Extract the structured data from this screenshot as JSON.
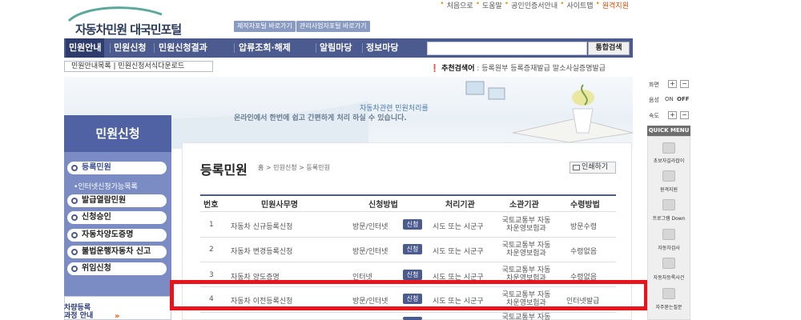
{
  "header": {
    "logo_text": "자동차민원 대국민포털",
    "btn_manufacturer": "제작자포털 바로가기",
    "btn_management": "관리사업자포털 바로가기",
    "top_links": [
      "처음으로",
      "도움말",
      "공인인증서안내",
      "사이트맵",
      "원격지원"
    ]
  },
  "nav": {
    "items": [
      "민원안내",
      "민원신청",
      "민원신청결과",
      "압류조회·해제",
      "알림마당",
      "정보마당"
    ],
    "search_button": "통합검색"
  },
  "subnav": {
    "text": "민원안내목록 | 민원신청서식다운로드"
  },
  "recommend": {
    "label": "추천검색어",
    "terms": "등록원부   등록증재발급   말소사실증명발급"
  },
  "banner": {
    "line1": "자동차관련 민원처리를",
    "line2": "온라인에서 한번에 쉽고 간편하게 처리 하실 수 있습니다."
  },
  "sidebar": {
    "title": "민원신청",
    "items": [
      "등록민원",
      "발급열람민원",
      "신청승인",
      "자동차양도증명",
      "불법운행자동차 신고",
      "위임신청"
    ],
    "sub_item": "인터넷신청가능목록",
    "promo_line1": "차량등록",
    "promo_line2": "과정 안내",
    "promo_arrow": "»"
  },
  "content": {
    "title": "등록민원",
    "breadcrumb": "홈  >  민원신청  >  등록민원",
    "print_label": "인쇄하기",
    "apply_label": "신청",
    "columns": [
      "번호",
      "민원사무명",
      "신청방법",
      "처리기관",
      "소관기관",
      "수령방법"
    ],
    "rows": [
      {
        "no": "1",
        "name": "자동차 신규등록신청",
        "method": "방문/인터넷",
        "office": "시도 또는 시군구",
        "agency_1": "국토교통부 자동",
        "agency_2": "차운영보험과",
        "receive": "방문수령"
      },
      {
        "no": "2",
        "name": "자동차 변경등록신청",
        "method": "방문/인터넷",
        "office": "시도 또는 시군구",
        "agency_1": "국토교통부 자동",
        "agency_2": "차운영보험과",
        "receive": "수령없음"
      },
      {
        "no": "3",
        "name": "자동차 양도증명",
        "method": "인터넷",
        "office": "시도 또는 시군구",
        "agency_1": "국토교통부 자동",
        "agency_2": "차운영보험과",
        "receive": "수령없음"
      },
      {
        "no": "4",
        "name": "자동차 이전등록신청",
        "method": "방문/인터넷",
        "office": "시도 또는 시군구",
        "agency_1": "국토교통부 자동",
        "agency_2": "차운영보험과",
        "receive": "인터넷발급"
      },
      {
        "no": "",
        "name": "",
        "method": "",
        "office": "",
        "agency_1": "국토교통부 자동",
        "agency_2": "",
        "receive": ""
      }
    ]
  },
  "right_rail": {
    "zoom_label": "화면",
    "voice_label": "음성",
    "voice_on": "ON",
    "voice_off": "OFF",
    "speed_label": "속도",
    "plus": "+",
    "minus": "−",
    "quick_menu": "QUICK MENU",
    "quick_items": [
      "초보자길라잡이",
      "원격지원",
      "프로그램 Down",
      "자동차검사",
      "자동차등록사건",
      "자주묻는질문"
    ]
  },
  "colors": {
    "nav_bg": "#4b5b8f",
    "highlight": "#e8131b",
    "accent_orange": "#d34b00"
  }
}
